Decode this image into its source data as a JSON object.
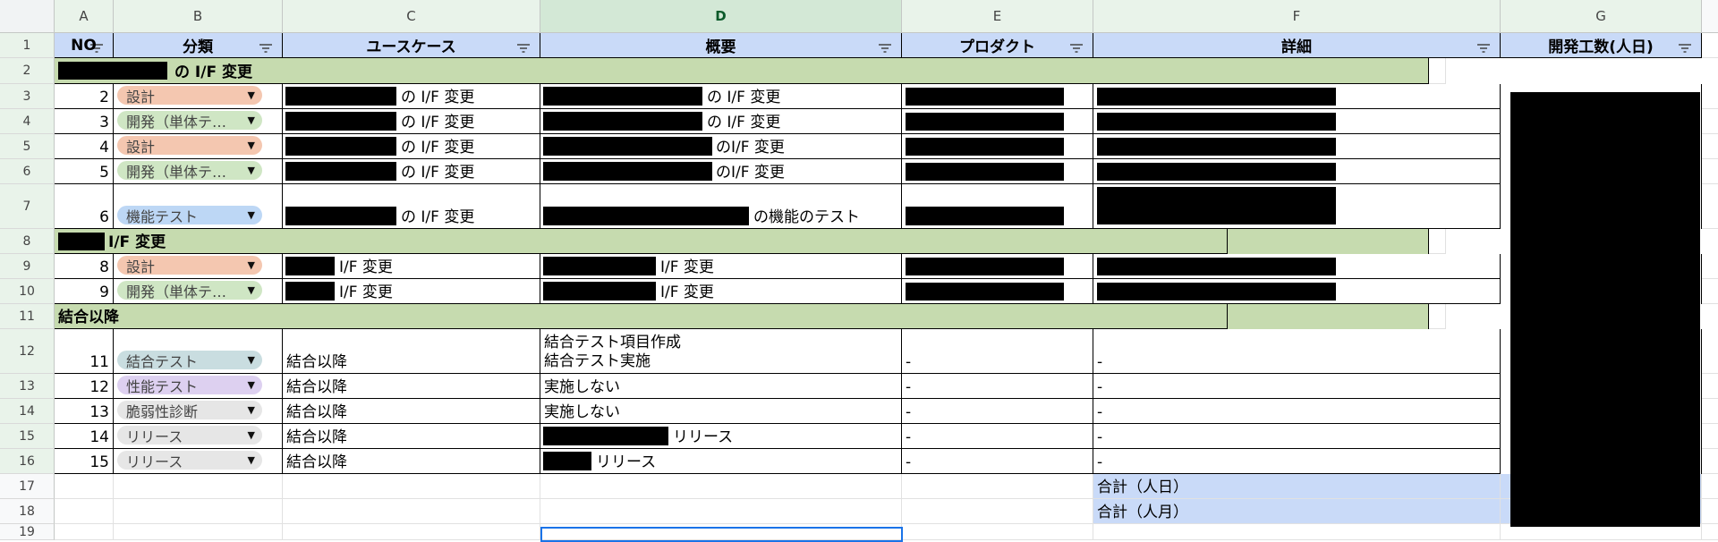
{
  "columns": [
    "A",
    "B",
    "C",
    "D",
    "E",
    "F",
    "G"
  ],
  "row_numbers": [
    "1",
    "2",
    "3",
    "4",
    "5",
    "6",
    "7",
    "8",
    "9",
    "10",
    "11",
    "12",
    "13",
    "14",
    "15",
    "16",
    "17",
    "18",
    "19"
  ],
  "headers": {
    "no": "NO",
    "category": "分類",
    "usecase": "ユースケース",
    "overview": "概要",
    "product": "プロダクト",
    "detail": "詳細",
    "effort": "開発工数(人日)"
  },
  "sections": {
    "s1": "の I/F 変更",
    "s2": "I/F 変更",
    "s3": "結合以降"
  },
  "chips": {
    "design": {
      "label": "設計",
      "color": "#f4c7b0"
    },
    "dev": {
      "label": "開発（単体テ…",
      "color": "#cfe6c4"
    },
    "func": {
      "label": "機能テスト",
      "color": "#bdd7f5"
    },
    "integ": {
      "label": "結合テスト",
      "color": "#c9dde0"
    },
    "perf": {
      "label": "性能テスト",
      "color": "#ddd0f0"
    },
    "vuln": {
      "label": "脆弱性診断",
      "color": "#e6e6e6"
    },
    "release": {
      "label": "リリース",
      "color": "#e6e6e6"
    }
  },
  "rows": {
    "r3": {
      "no": "2",
      "usecase": "の I/F 変更",
      "overview": "の I/F 変更"
    },
    "r4": {
      "no": "3",
      "usecase": "の I/F 変更",
      "overview": "の I/F 変更"
    },
    "r5": {
      "no": "4",
      "usecase": "の I/F 変更",
      "overview": "のI/F 変更"
    },
    "r6": {
      "no": "5",
      "usecase": "の I/F 変更",
      "overview": "のI/F 変更"
    },
    "r7": {
      "no": "6",
      "usecase": "の I/F 変更",
      "overview": "の機能のテスト"
    },
    "r9": {
      "no": "8",
      "usecase": "I/F 変更",
      "overview": "I/F 変更"
    },
    "r10": {
      "no": "9",
      "usecase": "I/F 変更",
      "overview": "I/F 変更"
    },
    "r12": {
      "no": "11",
      "usecase": "結合以降",
      "overview1": "結合テスト項目作成",
      "overview2": "結合テスト実施",
      "product": "-",
      "detail": "-"
    },
    "r13": {
      "no": "12",
      "usecase": "結合以降",
      "overview": "実施しない",
      "product": "-",
      "detail": "-"
    },
    "r14": {
      "no": "13",
      "usecase": "結合以降",
      "overview": "実施しない",
      "product": "-",
      "detail": "-"
    },
    "r15": {
      "no": "14",
      "usecase": "結合以降",
      "overview": "リリース",
      "product": "-",
      "detail": "-"
    },
    "r16": {
      "no": "15",
      "usecase": "結合以降",
      "overview": "リリース",
      "product": "-",
      "detail": "-"
    }
  },
  "totals": {
    "days": "合計（人日）",
    "months": "合計（人月）"
  }
}
